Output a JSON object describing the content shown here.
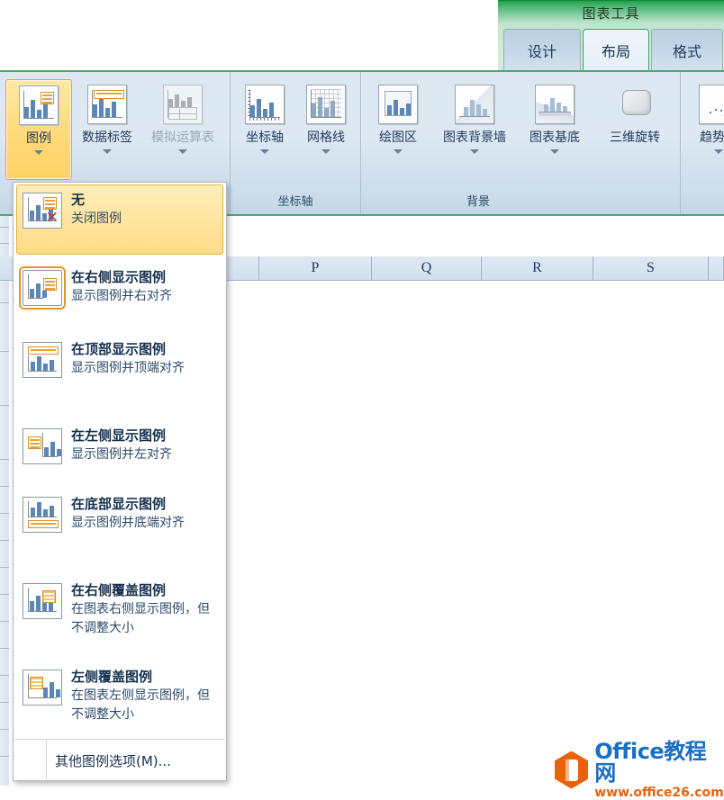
{
  "context_header": {
    "title": "图表工具",
    "accent_green": "#21a14c"
  },
  "tabs": [
    {
      "label": "设计",
      "active": false
    },
    {
      "label": "布局",
      "active": true
    },
    {
      "label": "格式",
      "active": false
    }
  ],
  "ribbon": {
    "groups": [
      {
        "title": "",
        "buttons": [
          {
            "label": "图例",
            "icon": "chart-legend-icon",
            "has_caret": true,
            "state": "selected"
          },
          {
            "label": "数据标签",
            "icon": "chart-data-labels-icon",
            "has_caret": true,
            "state": "normal"
          },
          {
            "label": "模拟运算表",
            "icon": "chart-data-table-icon",
            "has_caret": true,
            "state": "disabled"
          }
        ]
      },
      {
        "title": "坐标轴",
        "buttons": [
          {
            "label": "坐标轴",
            "icon": "chart-axes-icon",
            "has_caret": true,
            "state": "normal"
          },
          {
            "label": "网格线",
            "icon": "chart-gridlines-icon",
            "has_caret": true,
            "state": "normal"
          }
        ]
      },
      {
        "title": "背景",
        "buttons": [
          {
            "label": "绘图区",
            "icon": "chart-plot-area-icon",
            "has_caret": true,
            "state": "normal"
          },
          {
            "label": "图表背景墙",
            "icon": "chart-wall-icon",
            "has_caret": true,
            "state": "normal"
          },
          {
            "label": "图表基底",
            "icon": "chart-floor-icon",
            "has_caret": true,
            "state": "normal"
          },
          {
            "label": "三维旋转",
            "icon": "chart-3d-rotation-icon",
            "has_caret": false,
            "state": "normal"
          }
        ]
      },
      {
        "title": "",
        "buttons": [
          {
            "label": "趋势线",
            "icon": "chart-trendline-icon",
            "has_caret": true,
            "state": "normal"
          }
        ]
      }
    ]
  },
  "legend_menu": {
    "items": [
      {
        "title": "无",
        "desc": "关闭图例",
        "icon": "legend-none-icon",
        "highlighted": true,
        "checked": false
      },
      {
        "title": "在右侧显示图例",
        "desc": "显示图例并右对齐",
        "icon": "legend-right-icon",
        "highlighted": false,
        "checked": true
      },
      {
        "title": "在顶部显示图例",
        "desc": "显示图例并顶端对齐",
        "icon": "legend-top-icon",
        "highlighted": false,
        "checked": false
      },
      {
        "title": "在左侧显示图例",
        "desc": "显示图例并左对齐",
        "icon": "legend-left-icon",
        "highlighted": false,
        "checked": false
      },
      {
        "title": "在底部显示图例",
        "desc": "显示图例并底端对齐",
        "icon": "legend-bottom-icon",
        "highlighted": false,
        "checked": false
      },
      {
        "title": "在右侧覆盖图例",
        "desc": "在图表右侧显示图例，但不调整大小",
        "icon": "legend-overlay-right-icon",
        "highlighted": false,
        "checked": false
      },
      {
        "title": "左侧覆盖图例",
        "desc": "在图表左侧显示图例，但不调整大小",
        "icon": "legend-overlay-left-icon",
        "highlighted": false,
        "checked": false
      }
    ],
    "more_options": "其他图例选项(M)..."
  },
  "worksheet": {
    "columns": [
      "P",
      "Q",
      "R",
      "S"
    ]
  },
  "watermark": {
    "brand": "Office教程网",
    "url": "www.office26.com",
    "brand_color": "#1a6fc4",
    "url_color": "#e8620c"
  }
}
